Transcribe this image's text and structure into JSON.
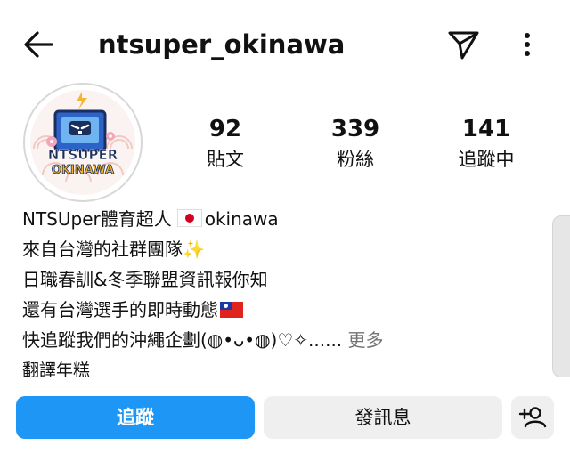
{
  "header": {
    "username": "ntsuper_okinawa",
    "back_icon": "back-arrow-icon",
    "send_icon": "paper-plane-icon",
    "more_icon": "more-vertical-icon"
  },
  "avatar": {
    "logo_text_top": "NTSUPER",
    "logo_text_bottom": "OKINAWA"
  },
  "stats": {
    "posts": {
      "value": "92",
      "label": "貼文"
    },
    "followers": {
      "value": "339",
      "label": "粉絲"
    },
    "following": {
      "value": "141",
      "label": "追蹤中"
    }
  },
  "bio": {
    "name": "NTSUper體育超人",
    "name_suffix": "okinawa",
    "line1": "來自台灣的社群團隊",
    "line2": "日職春訓&冬季聯盟資訊報你知",
    "line3": "還有台灣選手的即時動態",
    "line4": "快追蹤我們的沖繩企劃(⁠◍⁠•⁠ᴗ⁠•⁠◍⁠)⁠♡⁠✧...... ",
    "more_link": "更多",
    "translate": "翻譯年糕"
  },
  "actions": {
    "follow": "追蹤",
    "message": "發訊息",
    "add_user_icon": "add-person-icon"
  },
  "colors": {
    "accent": "#1e96f5",
    "secondary_button": "#efefef",
    "muted_text": "#737373"
  }
}
